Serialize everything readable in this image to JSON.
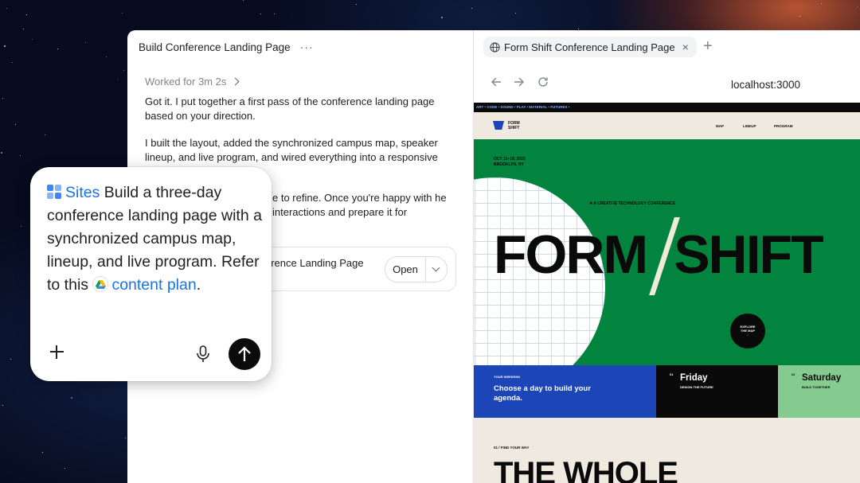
{
  "chat": {
    "title": "Build Conference Landing Page",
    "more_label": "···",
    "worked_for": "Worked for 3m 2s",
    "paragraphs": [
      "Got it. I put together a first pass of the conference landing page based on your direction.",
      "I built the layout, added the synchronized campus map, speaker lineup, and live program, and wired everything into a responsive",
      "e to refine. Once you're happy with he interactions and prepare it for"
    ],
    "artifact": {
      "title": "erence Landing Page",
      "open_label": "Open"
    }
  },
  "prompt": {
    "sites_label": "Sites",
    "text": " Build a three-day conference landing page with a synchronized campus map, lineup, and live program. Refer to this ",
    "link_label": "content plan",
    "end": "."
  },
  "browser": {
    "tab_title": "Form Shift Conference Landing Page",
    "tab_close": "×",
    "new_tab": "+",
    "url": "localhost:3000"
  },
  "site": {
    "ticker": "ART • CODE • SOUND • PLAY • MATERIAL • FUTURES •",
    "logo": "FORM SHIFT",
    "nav": [
      "MAP",
      "LINEUP",
      "PROGRAM"
    ],
    "date": "OCT 16–18, 2026",
    "location": "BROOKLYN, NY",
    "tag": "✱ A CREATIVE TECHNOLOGY CONFERENCE",
    "title_left": "FORM",
    "title_right": "SHIFT",
    "explore": "EXPLORE THE MAP",
    "explore_arrow": "↓",
    "weekend_label": "YOUR WEEKEND",
    "weekend_heading": "Choose a day to build your agenda.",
    "days": [
      {
        "num": "01",
        "name": "Friday",
        "sub": "DESIGN THE FUTURE"
      },
      {
        "num": "02",
        "name": "Saturday",
        "sub": "BUILD TOGETHER"
      }
    ],
    "section_label": "01 / FIND YOUR WAY",
    "section_title": "THE WHOLE"
  },
  "colors": {
    "hero_green": "#02843e",
    "brand_blue": "#1c46b8",
    "light_green": "#85ca8e",
    "link_blue": "#1a73e8"
  },
  "icons": [
    "sites-icon",
    "drive-icon",
    "plus-icon",
    "mic-icon",
    "send-arrow-icon",
    "globe-icon",
    "back-arrow-icon",
    "forward-arrow-icon",
    "reload-icon",
    "chevron-down-icon",
    "chevron-right-icon"
  ]
}
